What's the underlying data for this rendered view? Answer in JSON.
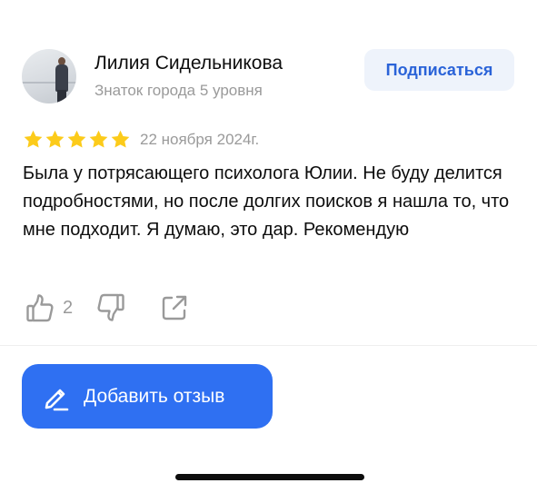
{
  "review": {
    "author": {
      "name": "Лилия Сидельникова",
      "level": "Знаток города 5 уровня",
      "avatar_icon": "user-photo"
    },
    "subscribe_label": "Подписаться",
    "rating": 5,
    "rating_max": 5,
    "date": "22 ноября 2024г.",
    "text": "Была у потрясающего психолога Юлии. Не буду делится подробностями, но после долгих поисков я нашла то, что мне подходит. Я думаю, это дар. Рекомендую",
    "likes": "2",
    "icons": {
      "like": "thumbs-up-icon",
      "dislike": "thumbs-down-icon",
      "share": "share-icon",
      "star": "star-icon"
    }
  },
  "add_review": {
    "label": "Добавить отзыв",
    "icon": "pen-icon"
  },
  "colors": {
    "accent": "#2f70f2",
    "subscribe_bg": "#eef3fb",
    "subscribe_text": "#2a63d8",
    "star": "#fccb1a",
    "muted": "#9a9a9a"
  }
}
